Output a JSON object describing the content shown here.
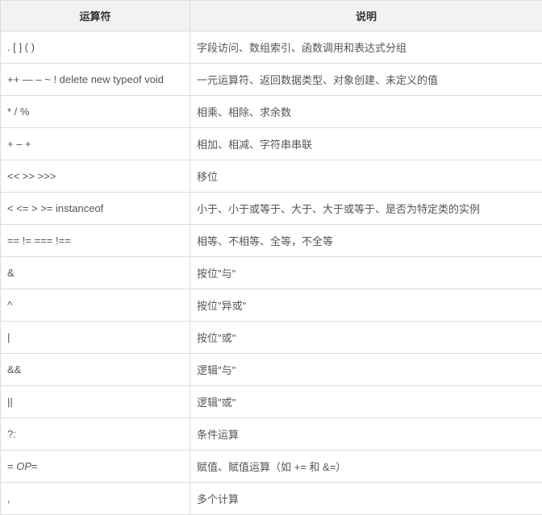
{
  "headers": {
    "operator": "运算符",
    "description": "说明"
  },
  "rows": [
    {
      "op": ". [ ] ( )",
      "desc": "字段访问、数组索引、函数调用和表达式分组"
    },
    {
      "op": "++ — – ~ ! delete new typeof void",
      "desc": "一元运算符、返回数据类型、对象创建、未定义的值"
    },
    {
      "op": "* / %",
      "desc": "相乘、相除、求余数"
    },
    {
      "op": "+ – +",
      "desc": "相加、相减、字符串串联"
    },
    {
      "op": "<< >> >>>",
      "desc": "移位"
    },
    {
      "op": "< <= > >= instanceof",
      "desc": "小于、小于或等于、大于、大于或等于、是否为特定类的实例"
    },
    {
      "op": "== != === !==",
      "desc": "相等、不相等、全等，不全等"
    },
    {
      "op": "&",
      "desc": "按位\"与\""
    },
    {
      "op": "^",
      "desc": "按位\"异或\""
    },
    {
      "op": "|",
      "desc": "按位\"或\""
    },
    {
      "op": "&&",
      "desc": "逻辑\"与\""
    },
    {
      "op": "||",
      "desc": "逻辑\"或\""
    },
    {
      "op": "?:",
      "desc": "条件运算"
    },
    {
      "op_html": "= <span class=\"italic\">OP</span>=",
      "desc": "赋值、赋值运算（如 += 和 &=）"
    },
    {
      "op": ",",
      "desc": "多个计算"
    }
  ]
}
